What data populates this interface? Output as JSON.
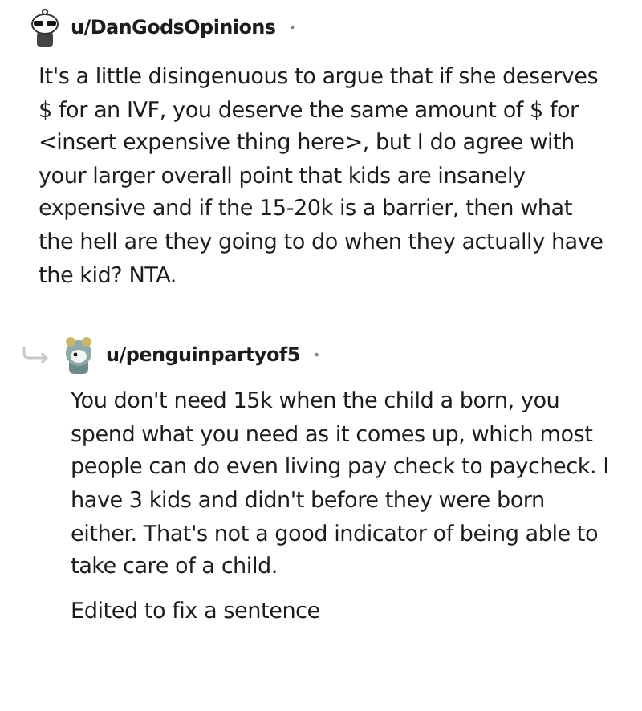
{
  "comments": [
    {
      "kind": "top",
      "username": "u/DanGodsOpinions",
      "separator": "•",
      "paragraphs": [
        "It's a little disingenuous to argue that if she deserves $ for an IVF, you deserve the same amount of $ for <insert expensive thing here>, but I do agree with your larger overall point that kids are insanely expensive and if the 15-20k is a barrier, then what the hell are they going to do when they actually have the kid? NTA."
      ]
    },
    {
      "kind": "reply",
      "username": "u/penguinpartyof5",
      "separator": "•",
      "paragraphs": [
        "You don't need 15k when the child a born, you spend what you need as it comes up, which most people can do even living pay check to paycheck. I have 3 kids and didn't before they were born either. That's not a good indicator of being able to take care of a child.",
        "Edited to fix a sentence"
      ]
    }
  ]
}
